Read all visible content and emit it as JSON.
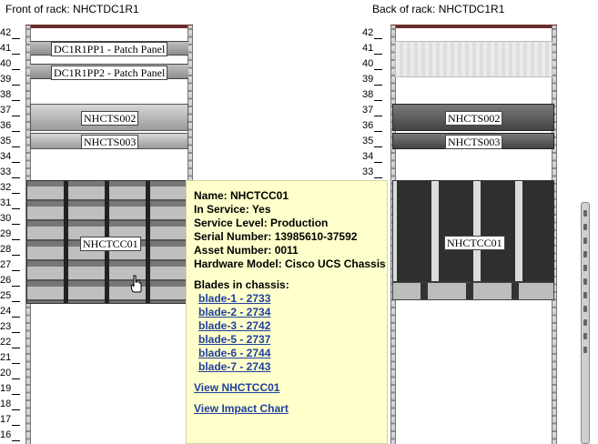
{
  "front": {
    "title": "Front of rack: NHCTDC1R1",
    "units": [
      "42",
      "41",
      "40",
      "39",
      "38",
      "37",
      "36",
      "35",
      "34",
      "33",
      "32",
      "31",
      "30",
      "29",
      "28",
      "27",
      "26",
      "25",
      "24",
      "23",
      "22",
      "21",
      "20",
      "19",
      "18",
      "17",
      "16"
    ],
    "devices": {
      "pp1": "DC1R1PP1 - Patch Panel",
      "pp2": "DC1R1PP2 - Patch Panel",
      "srv1": "NHCTS002",
      "srv2": "NHCTS003",
      "chassis": "NHCTCC01"
    }
  },
  "back": {
    "title": "Back of rack: NHCTDC1R1",
    "units": [
      "42",
      "41",
      "40",
      "39",
      "38",
      "37",
      "36",
      "35",
      "34",
      "33",
      "32",
      "31",
      "30",
      "29",
      "28",
      "27",
      "26",
      "25",
      "24",
      "23",
      "22",
      "21",
      "20",
      "19",
      "18",
      "17",
      "16"
    ],
    "devices": {
      "srv1": "NHCTS002",
      "srv2": "NHCTS003",
      "chassis": "NHCTCC01"
    }
  },
  "tooltip": {
    "name": "Name: NHCTCC01",
    "in_service": "In Service: Yes",
    "service_level": "Service Level: Production",
    "serial": "Serial Number: 13985610-37592",
    "asset": "Asset Number: 0011",
    "model": "Hardware Model: Cisco UCS Chassis",
    "blades_heading": "Blades in chassis:",
    "blades": [
      "blade-1 - 2733",
      "blade-2 - 2734",
      "blade-3 - 2742",
      "blade-5 - 2737",
      "blade-6 - 2744",
      "blade-7 - 2743"
    ],
    "view_link": "View NHCTCC01",
    "impact_link": "View Impact Chart"
  },
  "colors": {
    "tooltip_bg": "#ffffcc",
    "link": "#1f3f9c",
    "rail_cap": "#6b2c2c"
  }
}
